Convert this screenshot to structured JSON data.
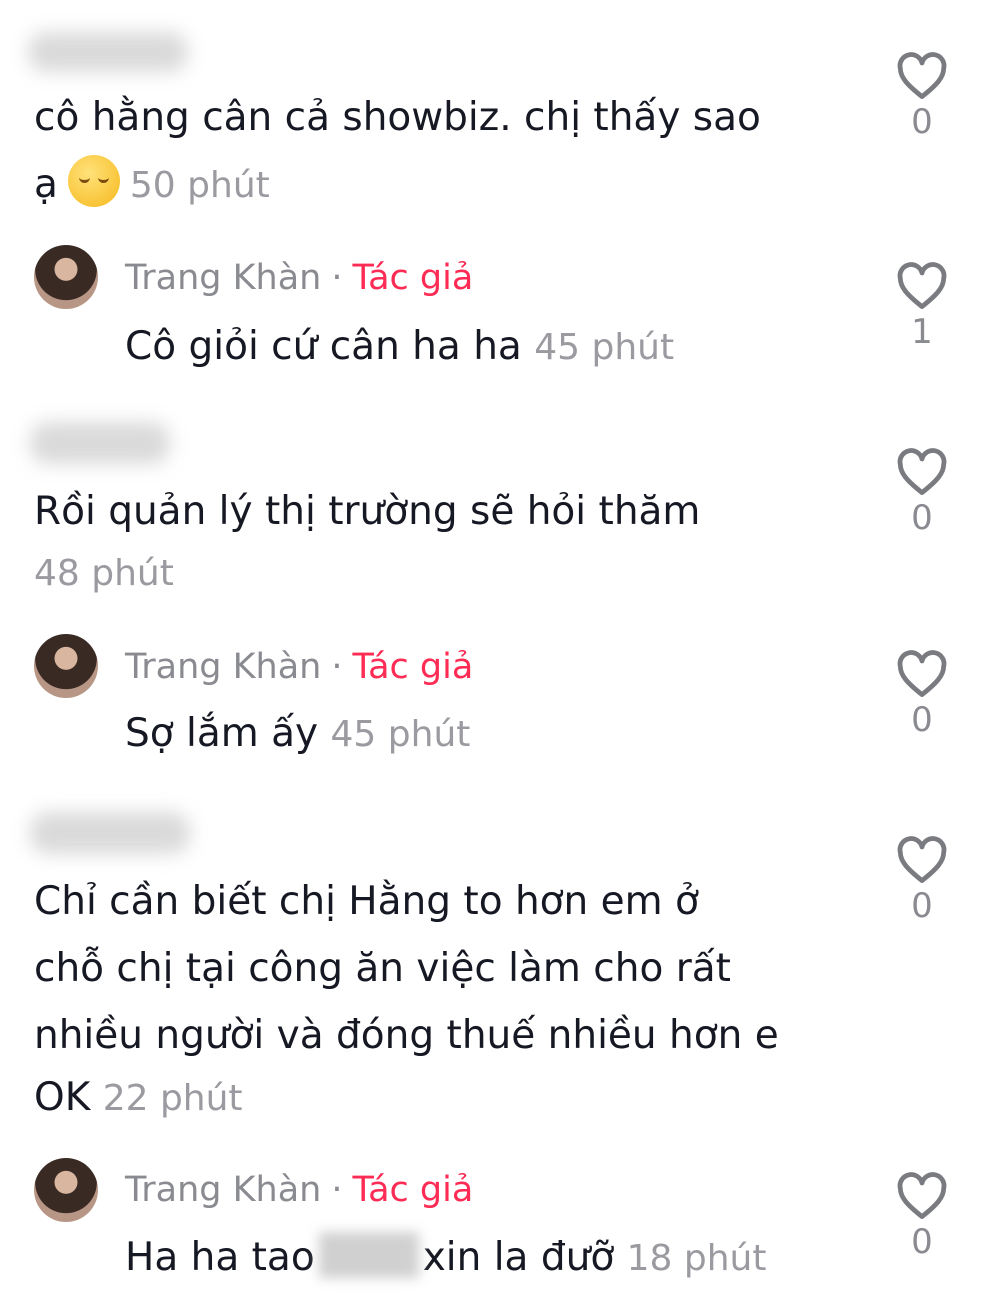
{
  "comments": [
    {
      "text_lines": [
        "cô hằng cân cả showbiz. chị thấy sao",
        "ạ"
      ],
      "emoji": "relieved-face",
      "time": "50 phút",
      "likes": "0"
    },
    {
      "author": "Trang Khàn",
      "author_tag": "Tác giả",
      "text": "Cô giỏi cứ cân ha ha",
      "time": "45 phút",
      "likes": "1"
    },
    {
      "text_lines": [
        "Rồi quản lý thị trường sẽ hỏi thăm"
      ],
      "time": "48 phút",
      "likes": "0"
    },
    {
      "author": "Trang Khàn",
      "author_tag": "Tác giả",
      "text": "Sợ lắm ấy",
      "time": "45 phút",
      "likes": "0"
    },
    {
      "text_lines": [
        "Chỉ cần biết chị Hằng to hơn em ở",
        "chỗ chị tại công ăn việc làm cho rất",
        "nhiều người và đóng thuế nhiều hơn e",
        "OK"
      ],
      "time": "22 phút",
      "likes": "0"
    },
    {
      "author": "Trang Khàn",
      "author_tag": "Tác giả",
      "text_before": "Ha ha tao",
      "text_after": "xin la đưỡ",
      "time": "18 phút",
      "likes": "0"
    }
  ],
  "colors": {
    "author_tag": "#fe2c55",
    "muted": "#8a8b91",
    "text": "#161823"
  },
  "icons": {
    "like": "heart-outline-icon"
  }
}
